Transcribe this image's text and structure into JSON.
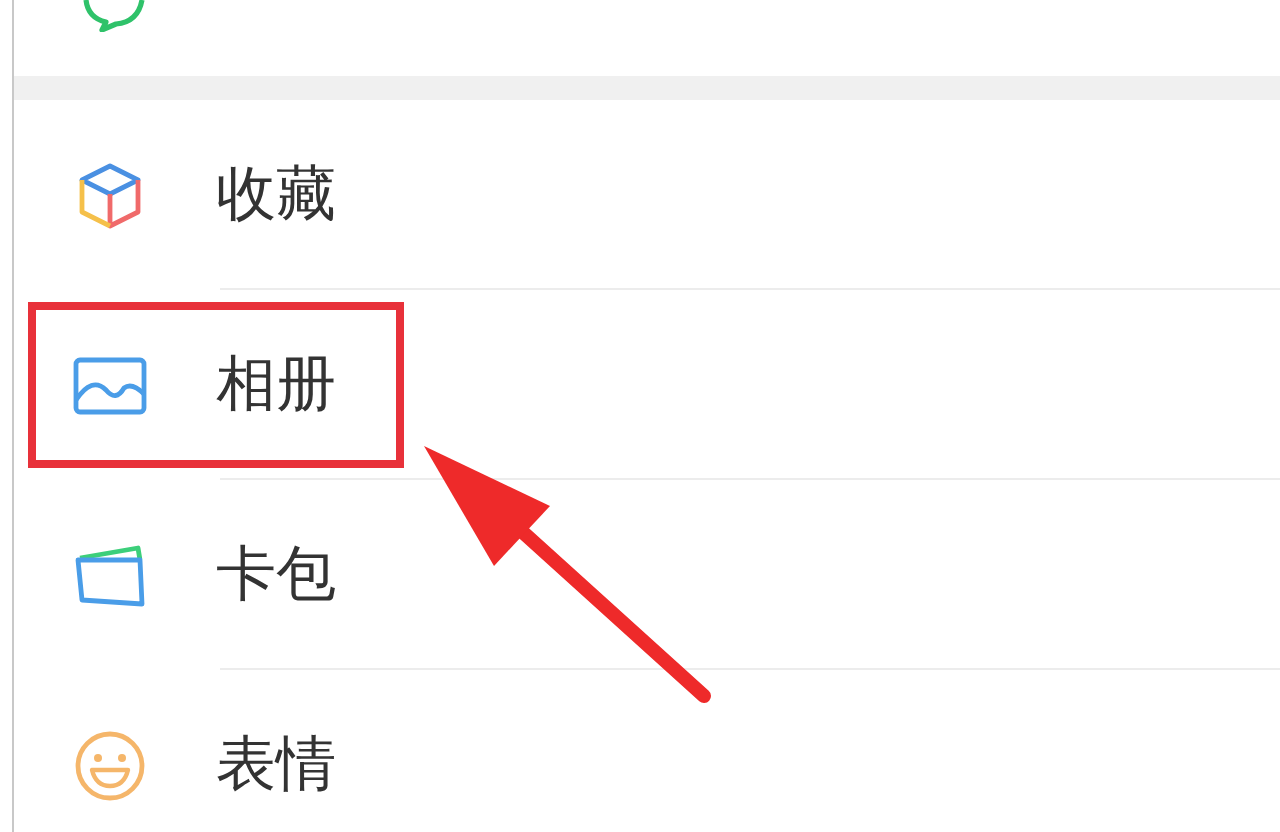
{
  "top_item": {
    "kind": "pay"
  },
  "items": [
    {
      "label": "收藏",
      "kind": "favorites",
      "highlighted": false
    },
    {
      "label": "相册",
      "kind": "album",
      "highlighted": true
    },
    {
      "label": "卡包",
      "kind": "cards",
      "highlighted": false
    },
    {
      "label": "表情",
      "kind": "stickers",
      "highlighted": false
    }
  ]
}
